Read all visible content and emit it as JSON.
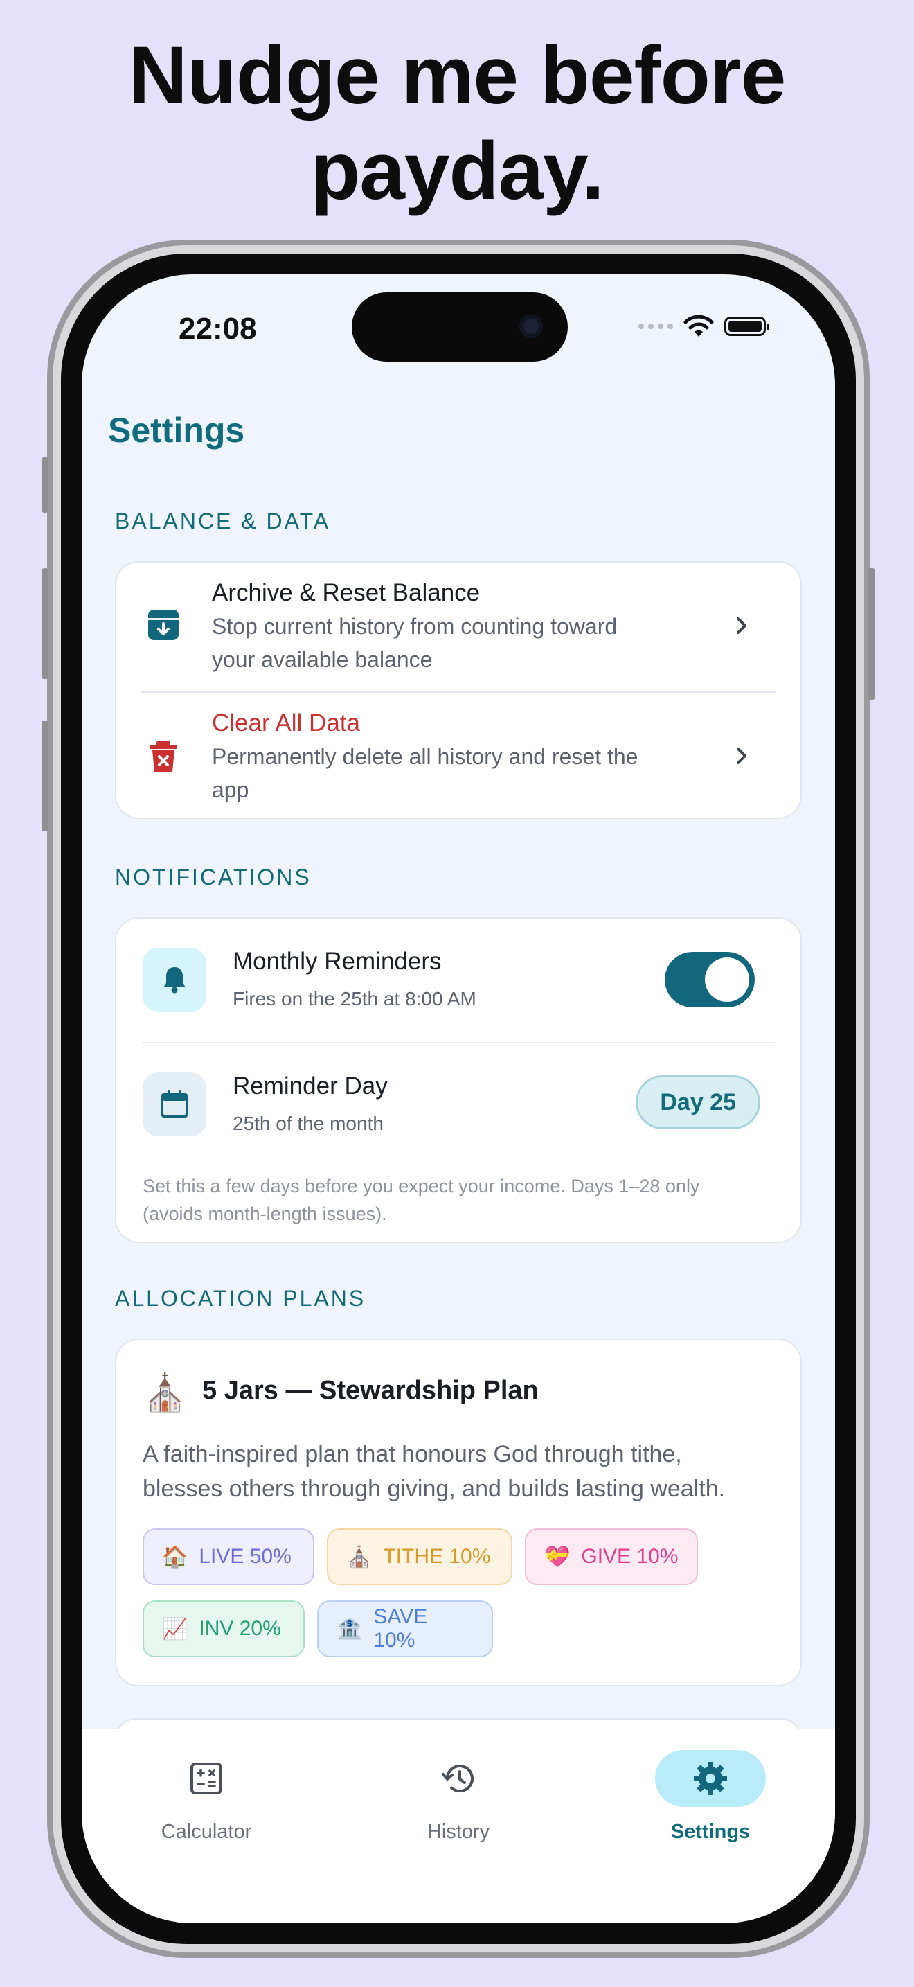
{
  "headline": {
    "line1": "Nudge me before",
    "line2": "payday."
  },
  "status_bar": {
    "time": "22:08"
  },
  "page_title": "Settings",
  "balance_section": {
    "title": "BALANCE & DATA",
    "archive": {
      "title": "Archive & Reset Balance",
      "subtitle_line1": "Stop current history from counting toward",
      "subtitle_line2": "your available balance",
      "icon": "archive-icon"
    },
    "clear": {
      "title": "Clear All Data",
      "subtitle_line1": "Permanently delete all history and reset the",
      "subtitle_line2": "app",
      "icon": "trash-icon"
    }
  },
  "notifications_section": {
    "title": "NOTIFICATIONS",
    "reminders": {
      "title": "Monthly Reminders",
      "subtitle": "Fires on the 25th at 8:00 AM",
      "enabled": true,
      "icon": "bell-icon"
    },
    "reminder_day": {
      "title": "Reminder Day",
      "subtitle": "25th of the month",
      "value": "Day 25",
      "icon": "calendar-icon"
    },
    "note_line1": "Set this a few days before you expect your income. Days 1–28 only",
    "note_line2": "(avoids month-length issues)."
  },
  "allocation_section": {
    "title": "ALLOCATION PLANS",
    "plan": {
      "emoji": "⛪",
      "name": "5 Jars — Stewardship Plan",
      "desc_line1": "A faith-inspired plan that honours God through tithe,",
      "desc_line2": "blesses others through giving, and builds lasting wealth.",
      "jars": [
        {
          "emoji": "🏠",
          "label": "LIVE 50%",
          "color": "#6f6bd6",
          "bg": "#eeeefc",
          "border": "#c9c7f2"
        },
        {
          "emoji": "⛪",
          "label": "TITHE 10%",
          "color": "#d79a2b",
          "bg": "#fdf3e2",
          "border": "#f2d7a4"
        },
        {
          "emoji": "💝",
          "label": "GIVE 10%",
          "color": "#de3f8f",
          "bg": "#fdeaf3",
          "border": "#f5bcd8"
        },
        {
          "emoji": "📈",
          "label": "INV 20%",
          "color": "#1f9e6e",
          "bg": "#e5f7ef",
          "border": "#a9e0c6"
        },
        {
          "emoji": "🏦",
          "label": "SAVE 10%",
          "color": "#4d7fd6",
          "bg": "#e8effc",
          "border": "#bcd0f3"
        }
      ]
    }
  },
  "tabbar": {
    "tabs": [
      {
        "label": "Calculator",
        "icon": "calculator-icon",
        "active": false
      },
      {
        "label": "History",
        "icon": "history-icon",
        "active": false
      },
      {
        "label": "Settings",
        "icon": "gear-icon",
        "active": true
      }
    ]
  },
  "colors": {
    "accent": "#13677c",
    "danger": "#c8312f",
    "background": "#e6e1fb"
  }
}
